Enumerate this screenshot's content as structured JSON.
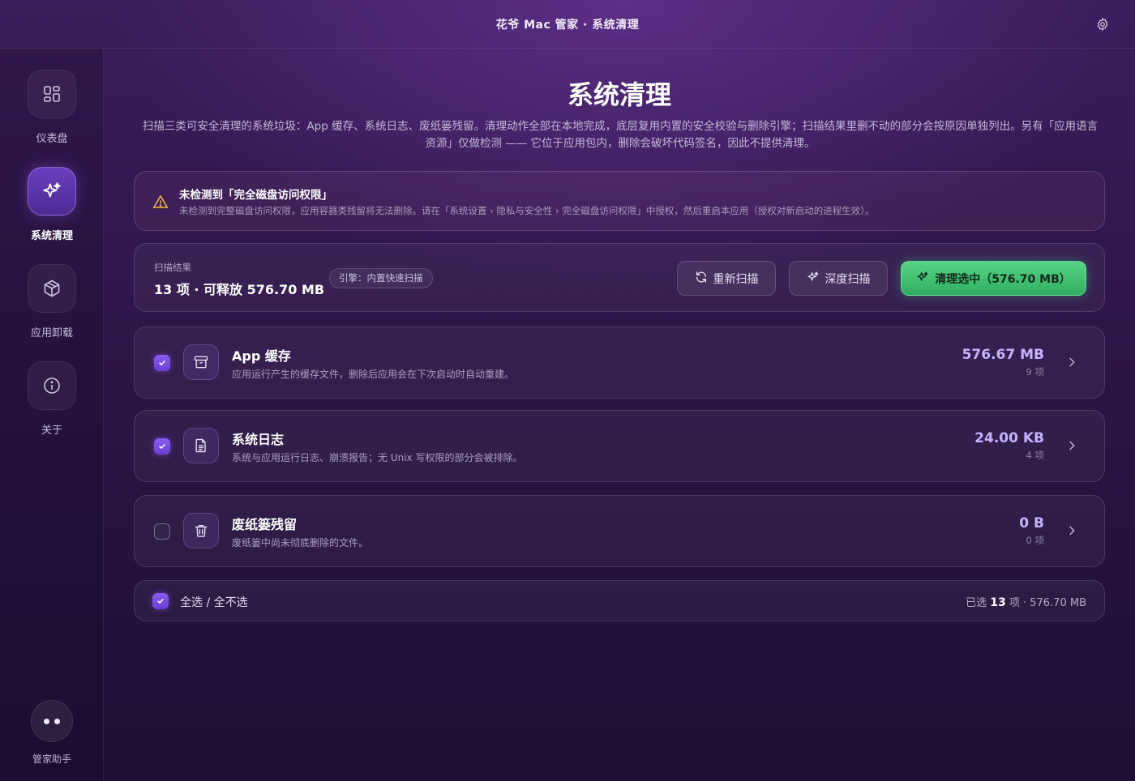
{
  "window": {
    "title": "花爷 Mac 管家 · 系统清理"
  },
  "sidebar": {
    "items": [
      {
        "label": "仪表盘",
        "icon": "dashboard-icon",
        "active": false
      },
      {
        "label": "系统清理",
        "icon": "sparkles-icon",
        "active": true
      },
      {
        "label": "应用卸载",
        "icon": "package-icon",
        "active": false
      },
      {
        "label": "关于",
        "icon": "info-icon",
        "active": false
      }
    ],
    "assistant": {
      "label": "管家助手",
      "icon": "chat-dots-icon"
    }
  },
  "main": {
    "title": "系统清理",
    "description": "扫描三类可安全清理的系统垃圾：App 缓存、系统日志、废纸篓残留。清理动作全部在本地完成，底层复用内置的安全校验与删除引擎；扫描结果里删不动的部分会按原因单独列出。另有「应用语言资源」仅做检测 —— 它位于应用包内，删除会破坏代码签名，因此不提供清理。",
    "warning": {
      "title": "未检测到「完全磁盘访问权限」",
      "text": "未检测到完整磁盘访问权限，应用容器类残留将无法删除。请在「系统设置 › 隐私与安全性 › 完全磁盘访问权限」中授权，然后重启本应用（授权对新启动的进程生效）。"
    },
    "scan": {
      "label": "扫描结果",
      "summary": "13 项 · 可释放 576.70 MB",
      "engine": "引擎：内置快速扫描",
      "rescan_label": "重新扫描",
      "deep_label": "深度扫描",
      "clean_label": "清理选中（576.70 MB）"
    },
    "categories": [
      {
        "name": "App 缓存",
        "desc": "应用运行产生的缓存文件，删除后应用会在下次启动时自动重建。",
        "size": "576.67 MB",
        "count": "9 项",
        "checked": true,
        "icon": "archive-box-icon"
      },
      {
        "name": "系统日志",
        "desc": "系统与应用运行日志、崩溃报告；无 Unix 写权限的部分会被排除。",
        "size": "24.00 KB",
        "count": "4 项",
        "checked": true,
        "icon": "document-icon"
      },
      {
        "name": "废纸篓残留",
        "desc": "废纸篓中尚未彻底删除的文件。",
        "size": "0 B",
        "count": "0 项",
        "checked": false,
        "icon": "trash-icon"
      }
    ],
    "footer": {
      "select_all_label": "全选 / 全不选",
      "selected_prefix": "已选",
      "selected_count": "13",
      "selected_suffix": "项 · 576.70 MB"
    }
  },
  "colors": {
    "accent": "#7c4ee4",
    "primary_button": "#3cc06f",
    "warning": "#f2b84b"
  }
}
